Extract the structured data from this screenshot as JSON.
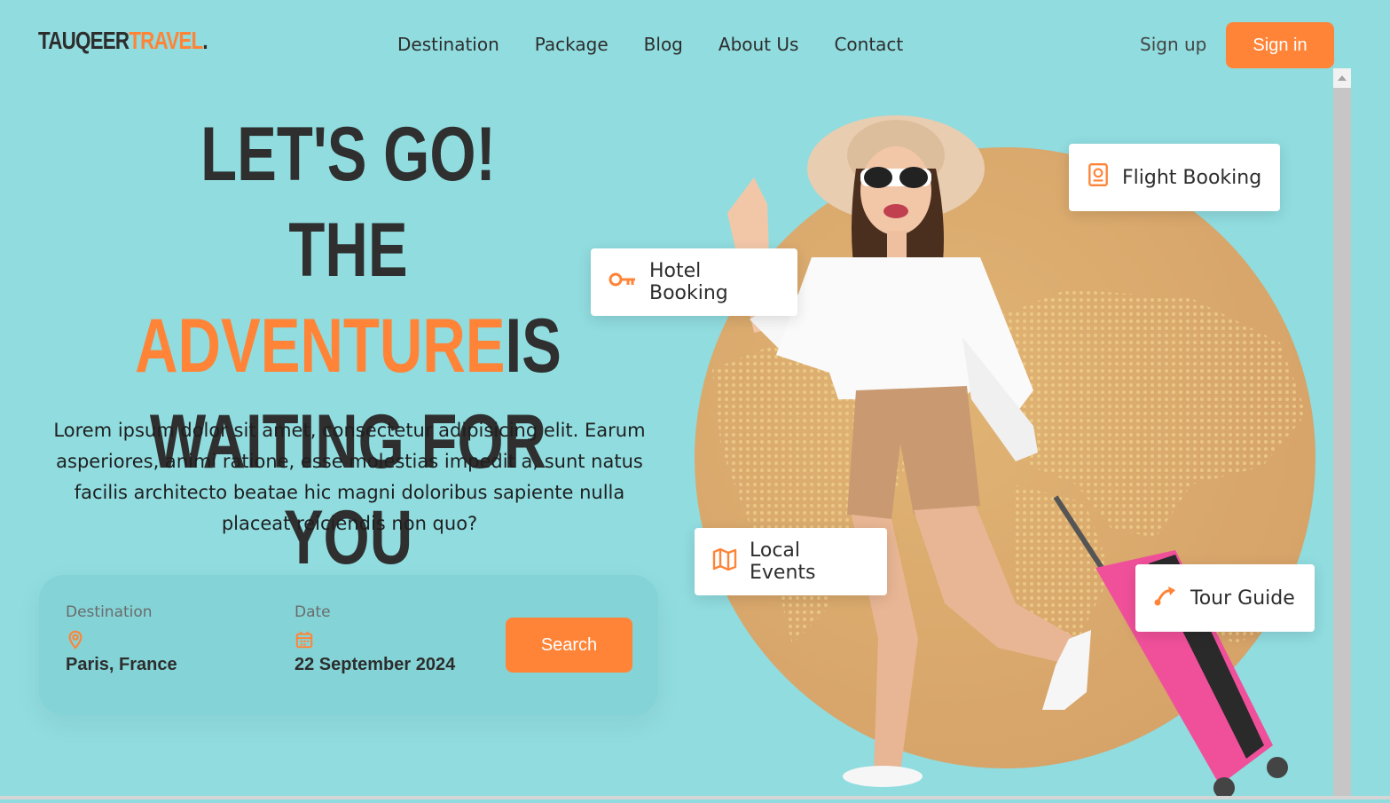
{
  "nav": {
    "logo_part1": "TAUQEER",
    "logo_part2": "TRAVEL",
    "logo_dot": ".",
    "links": [
      "Destination",
      "Package",
      "Blog",
      "About Us",
      "Contact"
    ],
    "signup": "Sign up",
    "signin": "Sign in"
  },
  "hero": {
    "line1": "LET'S GO!",
    "line2_pre": "THE ",
    "line2_highlight": "ADVENTURE",
    "line2_post": "IS",
    "line3": "WAITING FOR YOU",
    "description": "Lorem ipsum dolor sit amet, consectetur adipisicing elit. Earum asperiores, animi ratione, esse molestias impedit a, sunt natus facilis architecto beatae hic magni doloribus sapiente nulla placeat reiciendis non quo?"
  },
  "search": {
    "destination_label": "Destination",
    "destination_value": "Paris, France",
    "date_label": "Date",
    "date_value": "22 September 2024",
    "button": "Search"
  },
  "cards": {
    "flight": "Flight Booking",
    "hotel": "Hotel Booking",
    "events": "Local Events",
    "guide": "Tour Guide"
  },
  "colors": {
    "accent": "#FF8438",
    "background": "#90DCDF",
    "text": "#2d2d2d"
  }
}
